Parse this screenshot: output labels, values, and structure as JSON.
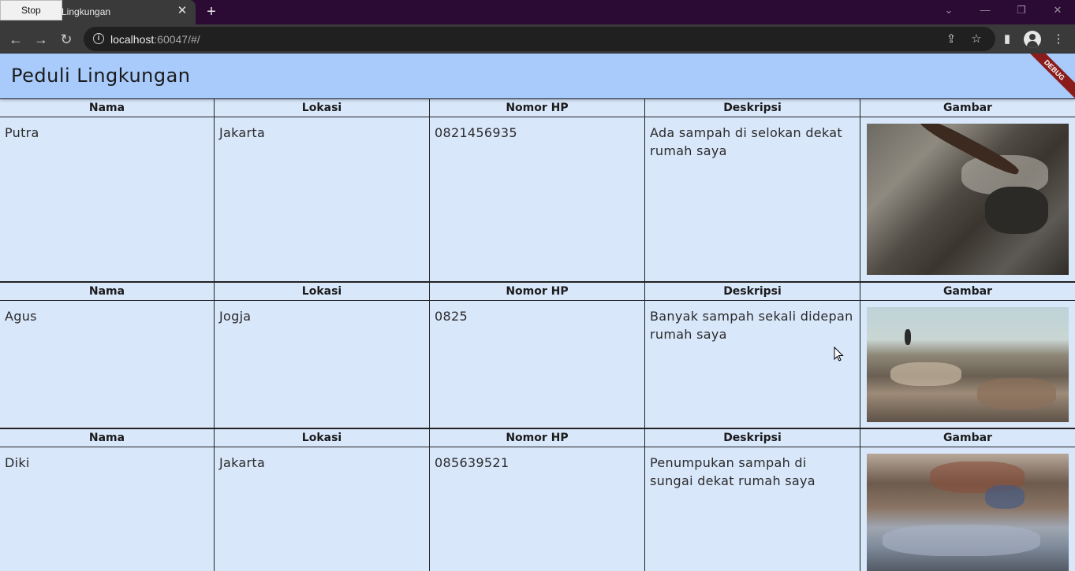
{
  "browser": {
    "tab_title": "Lingkungan",
    "tooltip": "Stop",
    "url_host": "localhost",
    "url_rest": ":60047/#/"
  },
  "app": {
    "title": "Peduli Lingkungan",
    "debug_label": "DEBUG"
  },
  "headers": [
    "Nama",
    "Lokasi",
    "Nomor HP",
    "Deskripsi",
    "Gambar"
  ],
  "records": [
    {
      "nama": "Putra",
      "lokasi": "Jakarta",
      "nomor_hp": "0821456935",
      "deskripsi": "Ada  sampah di selokan dekat rumah saya",
      "gambar": "trash-in-gutter-photo"
    },
    {
      "nama": "Agus",
      "lokasi": "Jogja",
      "nomor_hp": "0825",
      "deskripsi": "Banyak sampah sekali didepan rumah saya",
      "gambar": "trash-on-beach-photo"
    },
    {
      "nama": "Diki",
      "lokasi": "Jakarta",
      "nomor_hp": "085639521",
      "deskripsi": "Penumpukan sampah di sungai dekat rumah saya",
      "gambar": "trash-in-river-photo"
    }
  ],
  "colors": {
    "titlebar": "#2b0a33",
    "appbar": "#a8cbfb",
    "body": "#d9e7fb",
    "debug": "#8b1c1c"
  }
}
